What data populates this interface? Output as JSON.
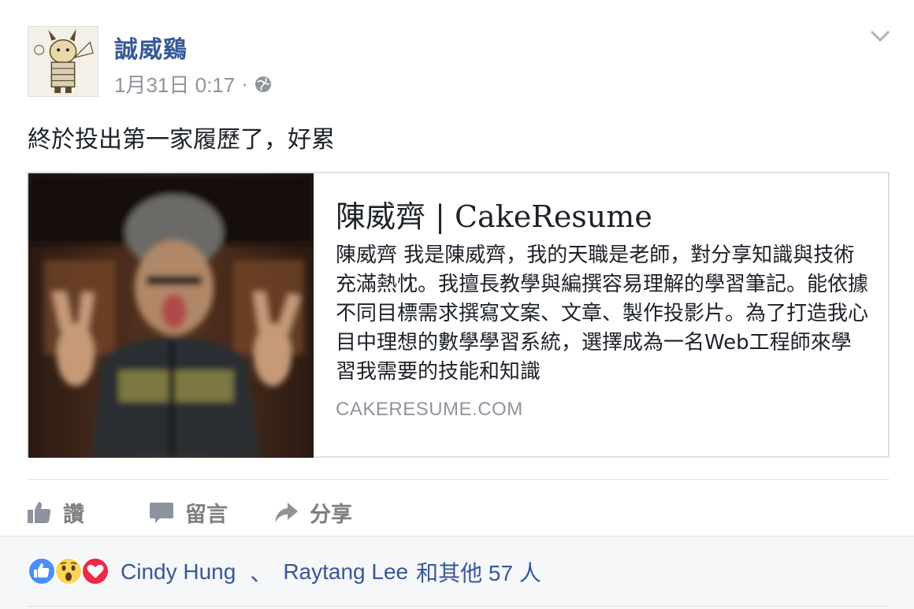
{
  "post": {
    "author": "誠威鷄",
    "date": "1月31日 0:17",
    "dot": "·",
    "status_text": "終於投出第一家履歷了，好累"
  },
  "link_preview": {
    "title": "陳威齊 | CakeResume",
    "description": "陳威齊 我是陳威齊，我的天職是老師，對分享知識與技術充滿熱忱。我擅長教學與編撰容易理解的學習筆記。能依據不同目標需求撰寫文案、文章、製作投影片。為了打造我心目中理想的數學學習系統，選擇成為一名Web工程師來學習我需要的技能和知識",
    "domain": "CAKERESUME.COM"
  },
  "actions": {
    "like": "讚",
    "comment": "留言",
    "share": "分享"
  },
  "reactions": {
    "icons": [
      "like-icon",
      "wow-icon",
      "love-icon"
    ],
    "name1": "Cindy Hung",
    "separator": "、",
    "name2": "Raytang Lee",
    "others": "和其他 57 人"
  },
  "colors": {
    "link_blue": "#365899",
    "meta_gray": "#90949c",
    "like_blue": "#4a8ff9",
    "love_red": "#f0284a",
    "wow_yellow": "#fcd65b"
  }
}
